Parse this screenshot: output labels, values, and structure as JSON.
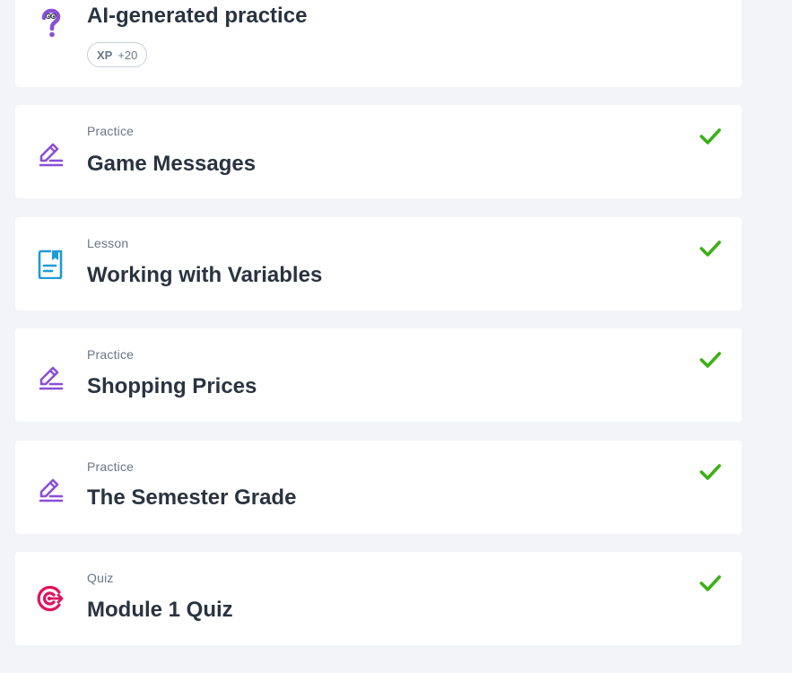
{
  "colors": {
    "background": "#f2f4f7",
    "card": "#ffffff",
    "practice_icon": "#8a4fd8",
    "lesson_icon": "#1e9bd7",
    "quiz_icon": "#e0135d",
    "check": "#3bb016",
    "title": "#2a3340",
    "muted": "#6b7686"
  },
  "items": [
    {
      "type": "",
      "title": "AI-generated practice",
      "icon": "question-mark-icon",
      "xp_label": "XP",
      "xp_value": "+20",
      "completed": false
    },
    {
      "type": "Practice",
      "title": "Game Messages",
      "icon": "pencil-icon",
      "completed": true
    },
    {
      "type": "Lesson",
      "title": "Working with Variables",
      "icon": "document-icon",
      "completed": true
    },
    {
      "type": "Practice",
      "title": "Shopping Prices",
      "icon": "pencil-icon",
      "completed": true
    },
    {
      "type": "Practice",
      "title": "The Semester Grade",
      "icon": "pencil-icon",
      "completed": true
    },
    {
      "type": "Quiz",
      "title": "Module 1 Quiz",
      "icon": "target-icon",
      "completed": true
    }
  ]
}
